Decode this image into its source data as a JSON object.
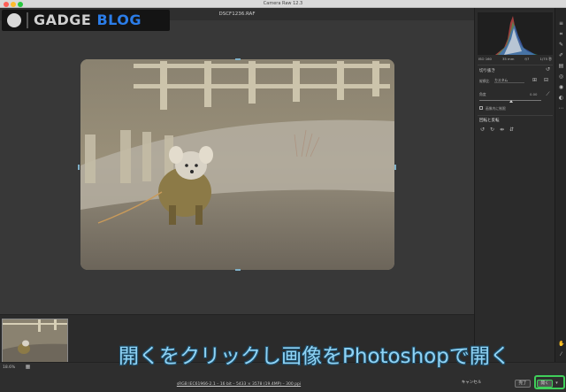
{
  "app": {
    "title": "Camera Raw 12.3",
    "file_name": "DSCF1236.RAF"
  },
  "logo": {
    "text_main": "GADGE ",
    "text_accent": "BLOG"
  },
  "panel": {
    "meta": [
      "ISO 160",
      "35 mm",
      "f/7",
      "1/75 秒"
    ],
    "profile_section": "切り抜き",
    "ratio_label": "縦横比",
    "ratio_value": "カスタム",
    "angle_label": "角度",
    "angle_value": "0.00",
    "constrain_label": "画像内に制限",
    "rotate_section": "回転と反転"
  },
  "bottom": {
    "zoom": "18.6%",
    "info": "sRGB IEC61966-2.1 – 16 bit – 5433 × 3578 (19.4MP) – 300 ppi",
    "cancel": "キャンセル",
    "done": "完了",
    "open": "開く"
  },
  "caption": "開くをクリックし画像をPhotoshopで開く",
  "colors": {
    "accent_green": "#3fcf5a",
    "caption_blue": "#8fd3f5",
    "logo_blue": "#2b7de9"
  }
}
